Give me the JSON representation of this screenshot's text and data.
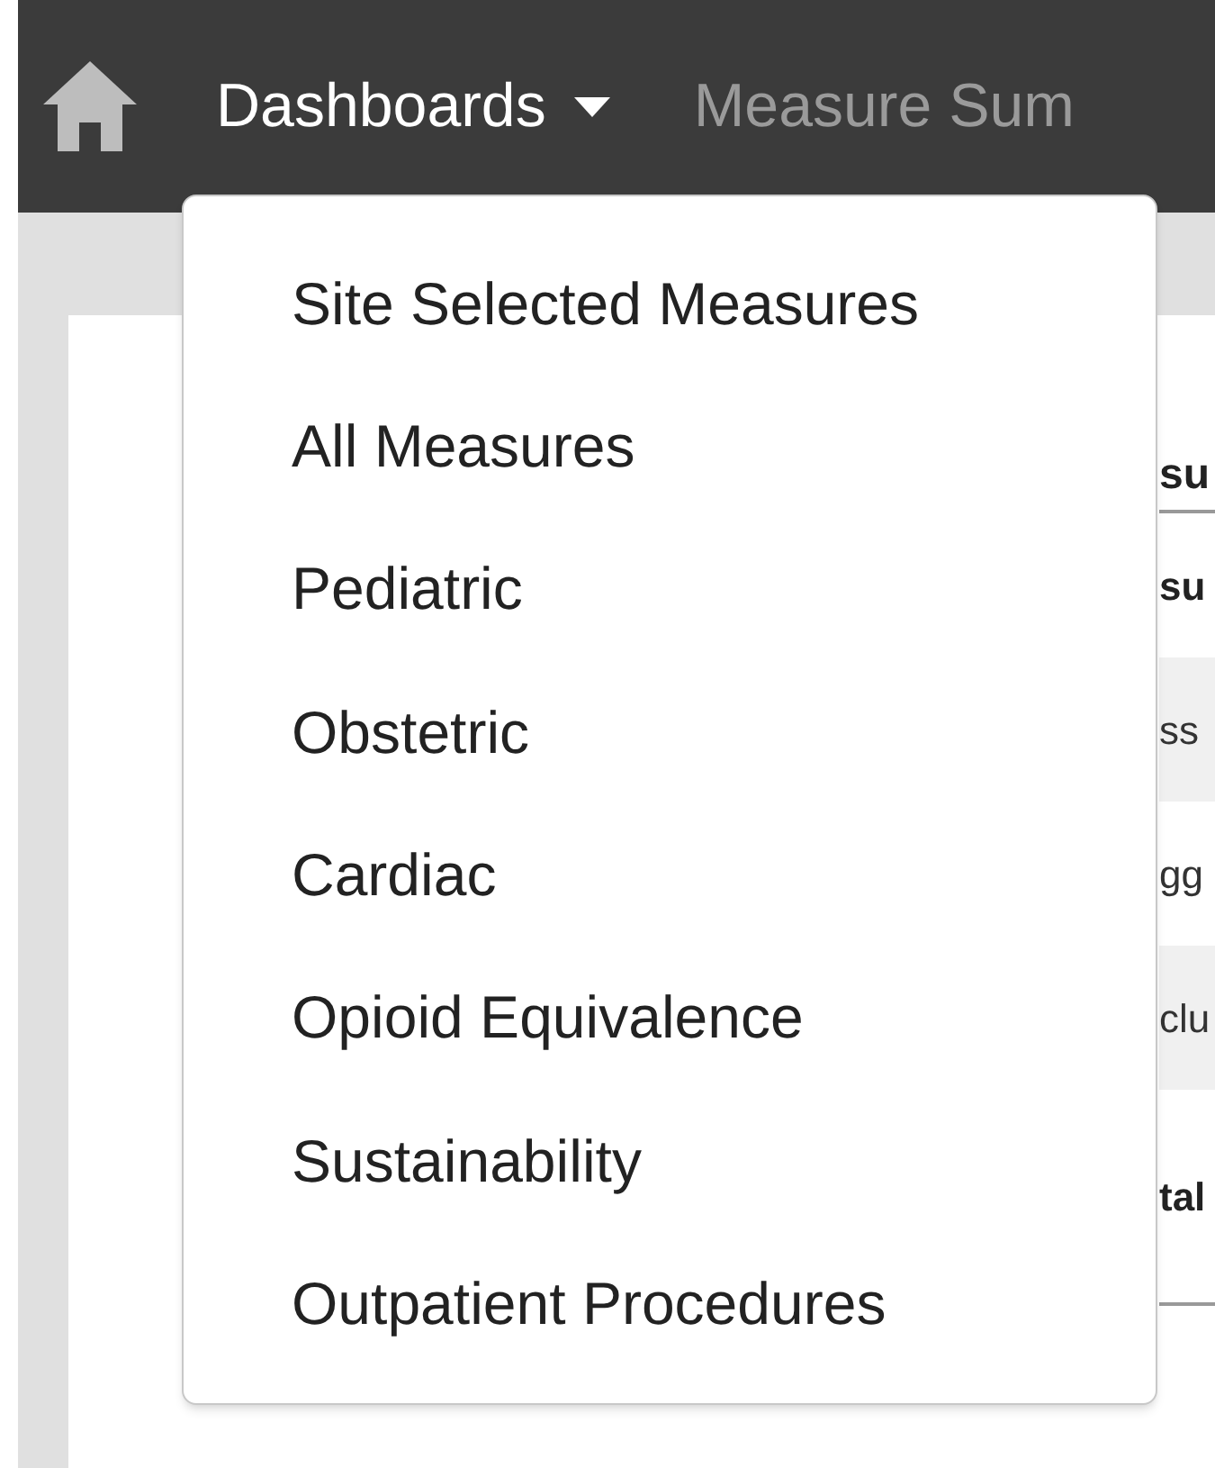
{
  "navbar": {
    "dashboards": {
      "label": "Dashboards",
      "expanded": true
    },
    "link": "Measure Sum"
  },
  "dropdown": {
    "items": [
      "Site Selected Measures",
      "All Measures",
      "Pediatric",
      "Obstetric",
      "Cardiac",
      "Opioid Equivalence",
      "Sustainability",
      "Outpatient Procedures"
    ]
  },
  "background": {
    "heading": "su",
    "rows": [
      {
        "kind": "header",
        "text": "su"
      },
      {
        "kind": "row",
        "text": "ss",
        "striped": true
      },
      {
        "kind": "row",
        "text": "gg",
        "striped": false
      },
      {
        "kind": "row",
        "text": "clu",
        "striped": true
      },
      {
        "kind": "total",
        "text": "tal"
      }
    ]
  }
}
